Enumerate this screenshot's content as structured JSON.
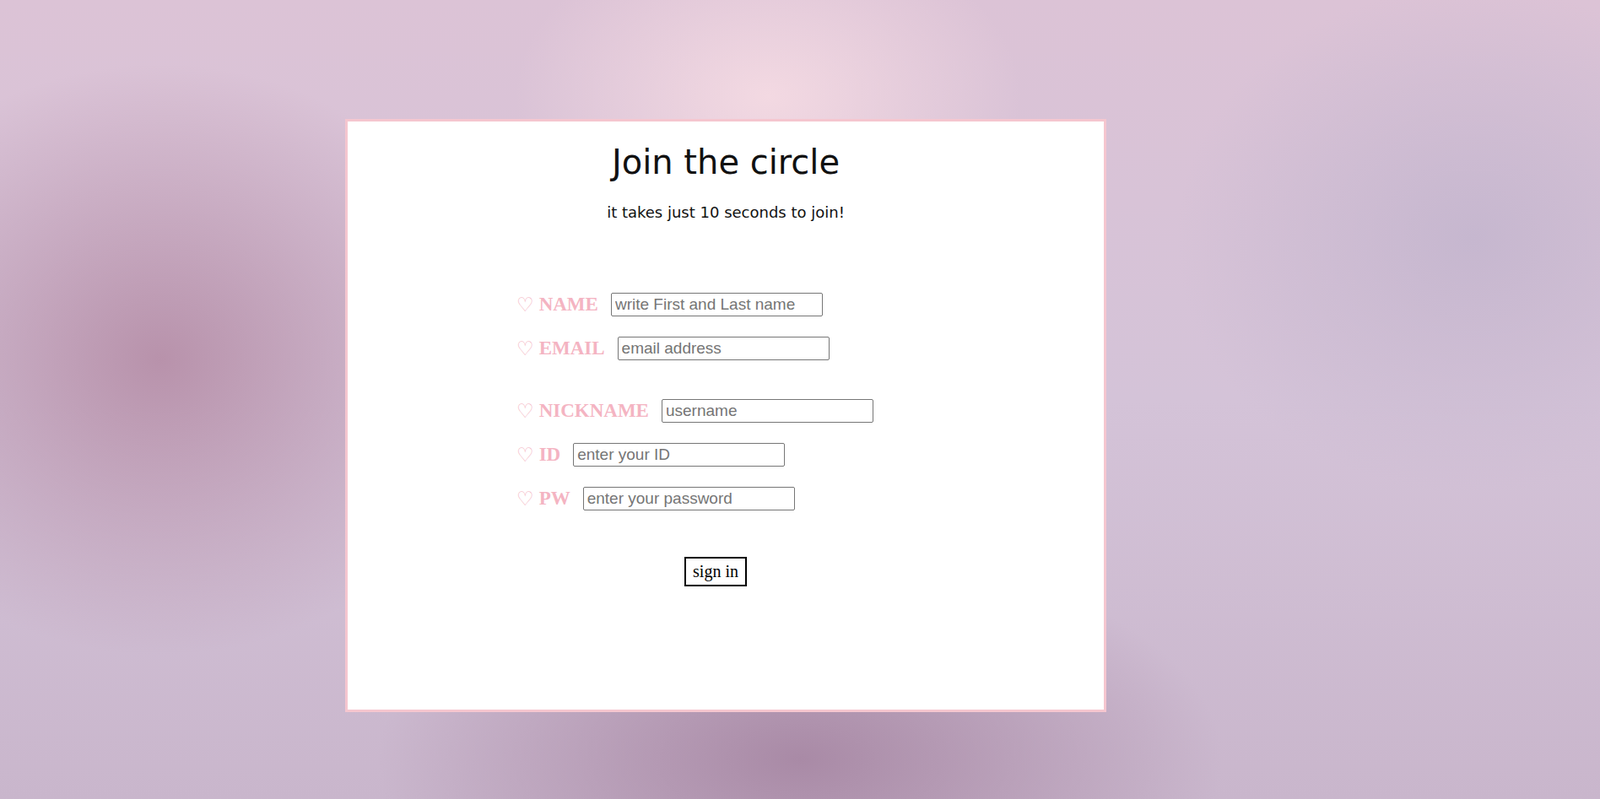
{
  "page": {
    "title": "Join the circle",
    "subtitle": "it takes just 10 seconds to join!"
  },
  "form": {
    "groups": [
      {
        "fields": [
          {
            "icon": "♡",
            "label": "NAME",
            "placeholder": "write First and Last name"
          },
          {
            "icon": "♡",
            "label": "EMAIL",
            "placeholder": "email address"
          }
        ]
      },
      {
        "fields": [
          {
            "icon": "♡",
            "label": "NICKNAME",
            "placeholder": "username"
          },
          {
            "icon": "♡",
            "label": "ID",
            "placeholder": "enter your ID"
          },
          {
            "icon": "♡",
            "label": "PW",
            "placeholder": "enter your password"
          }
        ]
      }
    ]
  },
  "buttons": [
    "sign in"
  ]
}
